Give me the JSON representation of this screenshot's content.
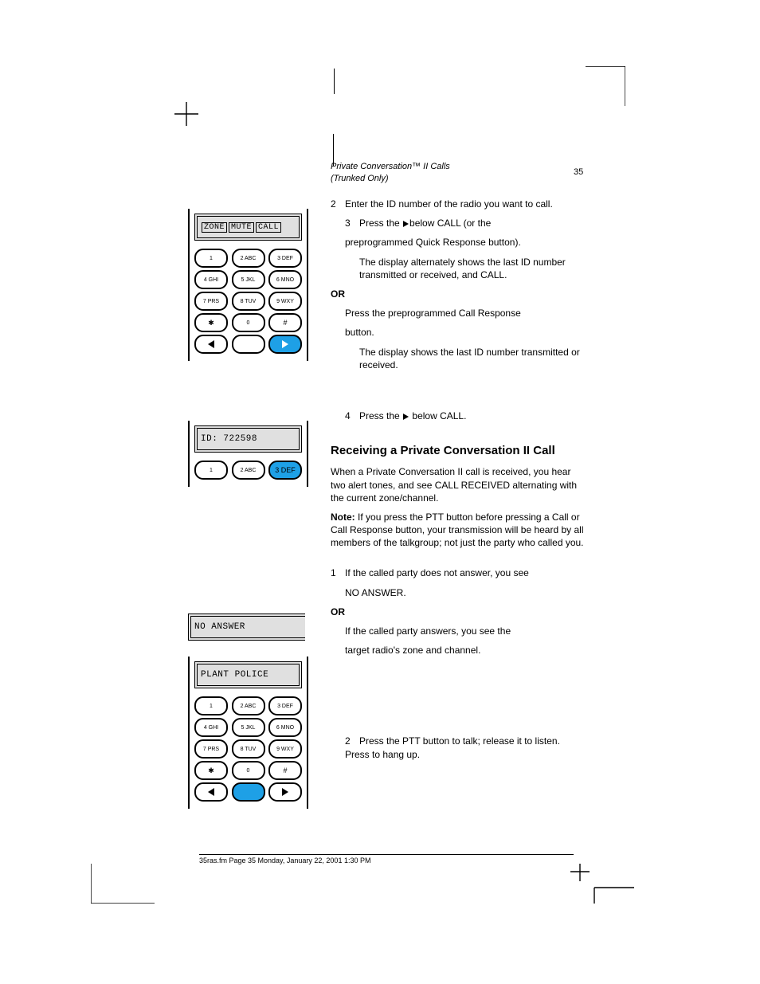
{
  "header": {
    "line1": "Private Conversation™ II Calls",
    "line2": "(Trunked Only)",
    "page": "35"
  },
  "body": {
    "or": "OR",
    "step2": {
      "num": "2",
      "text": "Enter the ID number of the radio you want to call."
    },
    "step3": {
      "num": "3",
      "text1": "Press the",
      "text2": "below CALL (or the",
      "text3": "preprogrammed Quick Response button).",
      "sub": "The display alternately shows the last ID number transmitted or received, and CALL."
    },
    "step3alt": {
      "a": "Press the preprogrammed Call Response",
      "b": "button.",
      "sub": "The display shows the last ID number transmitted or received."
    },
    "step4": {
      "num": "4",
      "text1": "Press the",
      "text2": "below CALL."
    },
    "heading": "Receiving a Private Conversation II Call",
    "recv": {
      "intro": "When a Private Conversation II call is received, you hear two alert tones, and see CALL RECEIVED alternating with the current zone/channel.",
      "noteLabel": "Note:",
      "note": "If you press the PTT button before pressing a Call or Call Response button, your transmission will be heard by all members of the talkgroup; not just the party who called you.",
      "s1": {
        "num": "1",
        "a": "If the called party does not answer, you see",
        "b": "NO ANSWER.",
        "c": "If the called party answers, you see the",
        "d": "target radio's zone and channel."
      },
      "s2": {
        "num": "2",
        "text": "Press the PTT button to talk; release it to listen. Press   to hang up."
      }
    }
  },
  "phones": {
    "keys": {
      "k1": "1",
      "k2": "2 ABC",
      "k3": "3 DEF",
      "k4": "4 GHI",
      "k5": "5 JKL",
      "k6": "6 MNO",
      "k7": "7 PRS",
      "k8": "8 TUV",
      "k9": "9 WXY",
      "k0": "0",
      "star": "✱",
      "hash": "#",
      "home": ""
    },
    "p1": {
      "lcd": [
        "ZONE",
        "MUTE",
        "CALL"
      ]
    },
    "p2": {
      "lcd": "ID: 722598"
    },
    "noAnswer": "NO ANSWER",
    "p3": {
      "lcd": "PLANT POLICE"
    }
  },
  "footer": {
    "left": "35ras.fm Page 35 Monday, January 22, 2001 1:30 PM",
    "right": ""
  }
}
